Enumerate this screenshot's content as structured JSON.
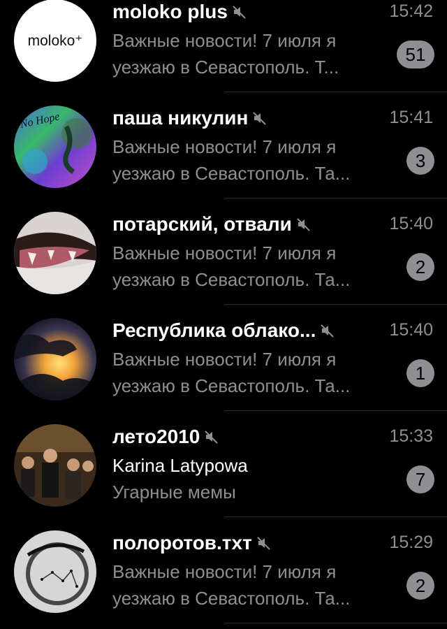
{
  "chats": [
    {
      "title": "moloko plus",
      "muted": true,
      "time": "15:42",
      "preview": "Важные новости! 7 июля я уезжаю в Севастополь. Т...",
      "sender": "",
      "unread": "51",
      "avatar_text": "moloko⁺"
    },
    {
      "title": "паша никулин",
      "muted": true,
      "time": "15:41",
      "preview": "Важные новости! 7 июля я уезжаю в Севастополь. Та...",
      "sender": "",
      "unread": "3",
      "avatar_text": "No Hope"
    },
    {
      "title": "потарский, отвали",
      "muted": true,
      "time": "15:40",
      "preview": "Важные новости! 7 июля я уезжаю в Севастополь. Та...",
      "sender": "",
      "unread": "2"
    },
    {
      "title": "Республика облако...",
      "muted": true,
      "time": "15:40",
      "preview": "Важные новости! 7 июля я уезжаю в Севастополь. Та...",
      "sender": "",
      "unread": "1"
    },
    {
      "title": "лето2010",
      "muted": true,
      "time": "15:33",
      "preview": "Угарные мемы",
      "sender": "Karina Latypowa",
      "unread": "7"
    },
    {
      "title": "полоротов.тхт",
      "muted": true,
      "time": "15:29",
      "preview": "Важные новости! 7 июля я уезжаю в Севастополь. Та...",
      "sender": "",
      "unread": "2"
    }
  ],
  "colors": {
    "background": "#000000",
    "secondary_text": "#8e8e93",
    "badge": "#8e8e93",
    "separator": "#2a2a2c"
  },
  "icons": {
    "mute": "speaker-muted-icon"
  }
}
